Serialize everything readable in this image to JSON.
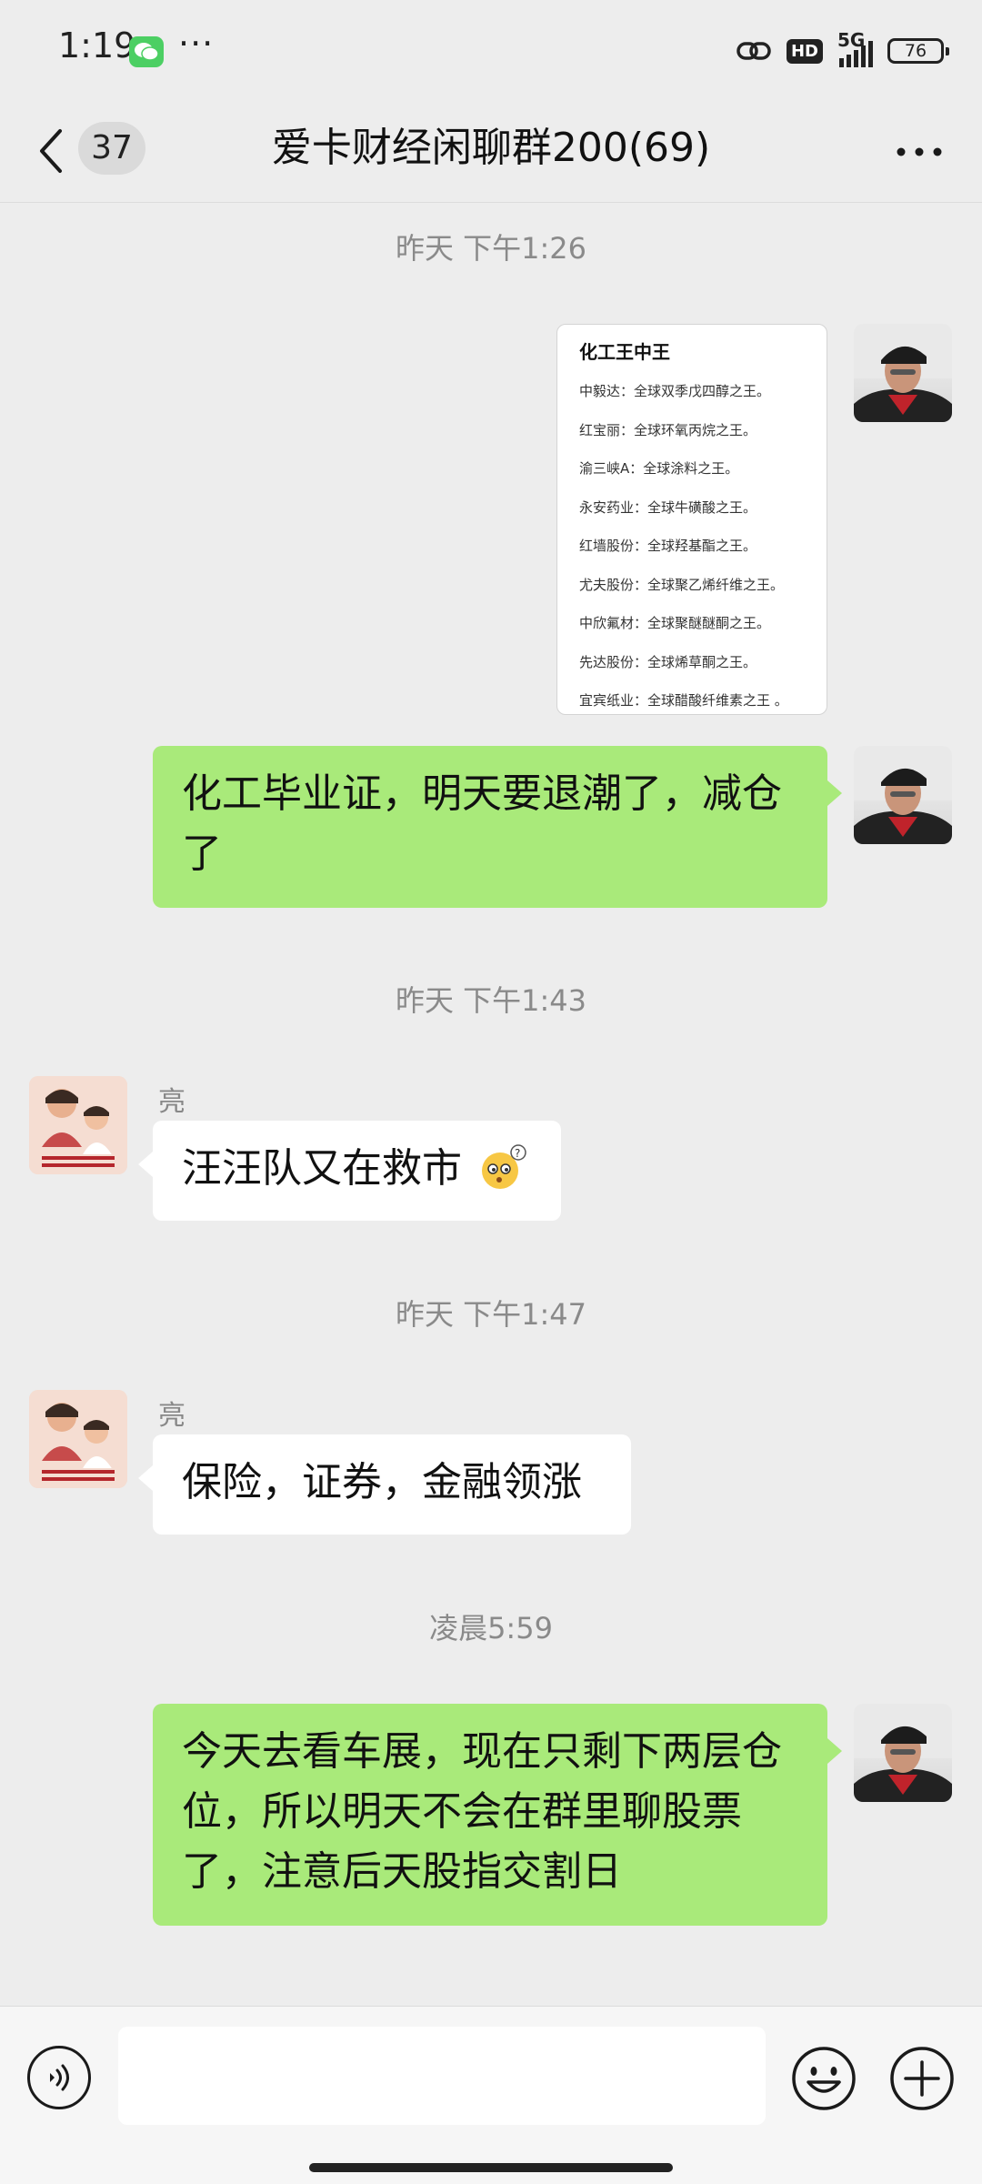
{
  "status_bar": {
    "time": "1:19",
    "more": "···",
    "hd_label": "HD",
    "network": "5G",
    "battery": "76",
    "icons": [
      "wechat-icon",
      "link-icon",
      "signal-icon",
      "battery-icon"
    ]
  },
  "header": {
    "unread_count": "37",
    "title": "爱卡财经闲聊群200(69)"
  },
  "image_card": {
    "title": "化工王中王",
    "lines": [
      "中毅达：全球双季戊四醇之王。",
      "红宝丽：全球环氧丙烷之王。",
      "渝三峡A：全球涂料之王。",
      "永安药业：全球牛磺酸之王。",
      "红墙股份：全球羟基酯之王。",
      "尤夫股份：全球聚乙烯纤维之王。",
      "中欣氟材：全球聚醚醚酮之王。",
      "先达股份：全球烯草酮之王。",
      "宜宾纸业：全球醋酸纤维素之王 。"
    ]
  },
  "messages": {
    "ts1": "昨天 下午1:26",
    "msg2": "化工毕业证，明天要退潮了，减仓了",
    "ts2": "昨天 下午1:43",
    "sender": "亮",
    "msg3": "汪汪队又在救市",
    "ts3": "昨天 下午1:47",
    "msg4": "保险，证券，金融领涨",
    "ts4": "凌晨5:59",
    "msg5": "今天去看车展，现在只剩下两层仓位，所以明天不会在群里聊股票了，注意后天股指交割日"
  },
  "input_bar": {
    "value": "",
    "icons": [
      "voice-icon",
      "emoji-icon",
      "plus-icon"
    ]
  },
  "colors": {
    "background": "#ededed",
    "bubble_self": "#a9ea7a",
    "bubble_other": "#ffffff",
    "wechat_green": "#4ccf63"
  }
}
